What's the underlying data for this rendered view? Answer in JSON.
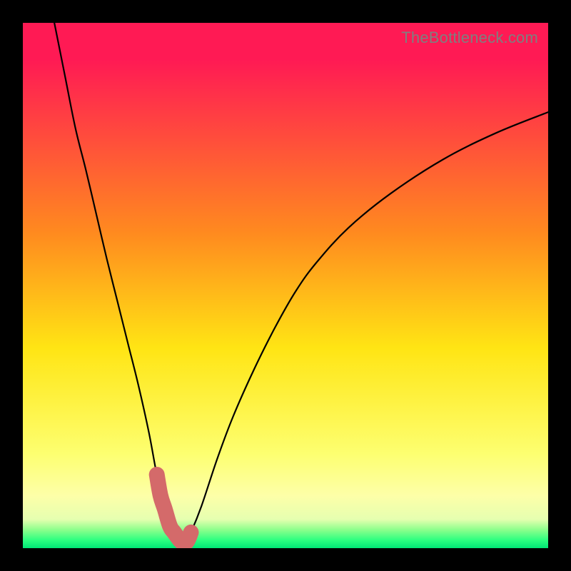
{
  "watermark": "TheBottleneck.com",
  "chart_data": {
    "type": "line",
    "title": "",
    "xlabel": "",
    "ylabel": "",
    "xlim": [
      0,
      100
    ],
    "ylim": [
      0,
      100
    ],
    "grid": false,
    "legend": false,
    "series": [
      {
        "name": "bottleneck-curve",
        "x": [
          6,
          8,
          10,
          12,
          14,
          16,
          18,
          20,
          22,
          24,
          25.5,
          27,
          28.5,
          30,
          31,
          32,
          34,
          37,
          40,
          44,
          48,
          52,
          56,
          62,
          70,
          80,
          90,
          100
        ],
        "y": [
          100,
          90,
          80,
          72,
          63.5,
          55,
          47,
          39,
          31,
          22,
          14,
          7.5,
          3,
          1.2,
          1.2,
          3,
          8,
          17,
          25,
          34,
          42,
          49,
          54.5,
          61,
          67.5,
          74,
          79,
          83
        ]
      },
      {
        "name": "highlight-segment",
        "x": [
          25.5,
          26.2,
          27,
          28,
          28.8,
          30.2,
          31.2,
          32
        ],
        "y": [
          14,
          10,
          7.5,
          4.2,
          3,
          1.2,
          1.2,
          3
        ]
      }
    ],
    "colors": {
      "curve": "#000000",
      "highlight": "#d46a6a",
      "gradient_stops": [
        {
          "offset": 0.0,
          "color": "#ff1a54"
        },
        {
          "offset": 0.07,
          "color": "#ff1a54"
        },
        {
          "offset": 0.4,
          "color": "#ff8a1f"
        },
        {
          "offset": 0.62,
          "color": "#ffe514"
        },
        {
          "offset": 0.82,
          "color": "#fdff70"
        },
        {
          "offset": 0.9,
          "color": "#fdffa8"
        },
        {
          "offset": 0.945,
          "color": "#e6ffb0"
        },
        {
          "offset": 0.965,
          "color": "#8cff8c"
        },
        {
          "offset": 0.985,
          "color": "#2bff80"
        },
        {
          "offset": 1.0,
          "color": "#00e676"
        }
      ]
    }
  }
}
